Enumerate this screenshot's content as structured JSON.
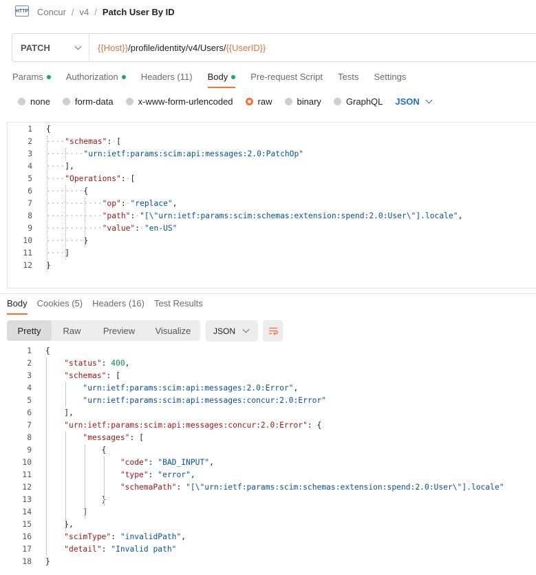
{
  "breadcrumb": {
    "icon_text": "HTTP",
    "items": [
      "Concur",
      "v4",
      "Patch User By ID"
    ],
    "separator": "/"
  },
  "request": {
    "method": "PATCH",
    "url_parts": [
      {
        "text": "{{Host}}",
        "var": true
      },
      {
        "text": "/profile/identity/v4/Users/",
        "var": false
      },
      {
        "text": "{{UserID}}",
        "var": true
      }
    ]
  },
  "request_tabs": [
    {
      "label": "Params",
      "dot": true,
      "active": false
    },
    {
      "label": "Authorization",
      "dot": true,
      "active": false
    },
    {
      "label": "Headers (11)",
      "dot": false,
      "active": false
    },
    {
      "label": "Body",
      "dot": true,
      "active": true
    },
    {
      "label": "Pre-request Script",
      "dot": false,
      "active": false
    },
    {
      "label": "Tests",
      "dot": false,
      "active": false
    },
    {
      "label": "Settings",
      "dot": false,
      "active": false
    }
  ],
  "body_types": [
    {
      "label": "none",
      "selected": false
    },
    {
      "label": "form-data",
      "selected": false
    },
    {
      "label": "x-www-form-urlencoded",
      "selected": false
    },
    {
      "label": "raw",
      "selected": true
    },
    {
      "label": "binary",
      "selected": false
    },
    {
      "label": "GraphQL",
      "selected": false
    }
  ],
  "body_language": "JSON",
  "request_body": [
    "{",
    "    \"schemas\": [",
    "        \"urn:ietf:params:scim:api:messages:2.0:PatchOp\"",
    "    ],",
    "    \"Operations\": [",
    "        {",
    "            \"op\": \"replace\",",
    "            \"path\": \"[\\\"urn:ietf:params:scim:schemas:extension:spend:2.0:User\\\"].locale\",",
    "            \"value\": \"en-US\"",
    "        }",
    "    ]",
    "}"
  ],
  "response_tabs": [
    {
      "label": "Body",
      "active": true
    },
    {
      "label": "Cookies (5)",
      "active": false
    },
    {
      "label": "Headers (16)",
      "active": false
    },
    {
      "label": "Test Results",
      "active": false
    }
  ],
  "view_modes": [
    {
      "label": "Pretty",
      "active": true
    },
    {
      "label": "Raw",
      "active": false
    },
    {
      "label": "Preview",
      "active": false
    },
    {
      "label": "Visualize",
      "active": false
    }
  ],
  "response_format": "JSON",
  "wrap_icon": "wrap-lines-icon",
  "accent_color": "#ff6c37",
  "response_body": [
    "{",
    "    \"status\": 400,",
    "    \"schemas\": [",
    "        \"urn:ietf:params:scim:api:messages:2.0:Error\",",
    "        \"urn:ietf:params:scim:api:messages:concur:2.0:Error\"",
    "    ],",
    "    \"urn:ietf:params:scim:api:messages:concur:2.0:Error\": {",
    "        \"messages\": [",
    "            {",
    "                \"code\": \"BAD_INPUT\",",
    "                \"type\": \"error\",",
    "                \"schemaPath\": \"[\\\"urn:ietf:params:scim:schemas:extension:spend:2.0:User\\\"].locale\"",
    "            }",
    "        ]",
    "    },",
    "    \"scimType\": \"invalidPath\",",
    "    \"detail\": \"Invalid path\"",
    "}"
  ]
}
